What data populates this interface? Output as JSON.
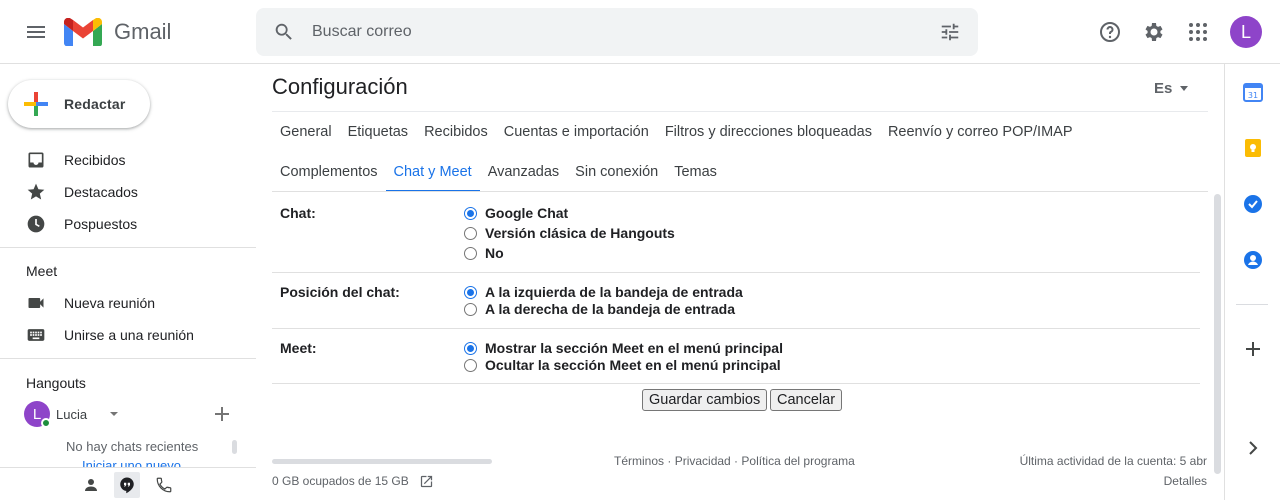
{
  "app": {
    "name": "Gmail"
  },
  "header": {
    "search_placeholder": "Buscar correo",
    "avatar_letter": "L"
  },
  "leftnav": {
    "compose_label": "Redactar",
    "items": [
      {
        "label": "Recibidos",
        "icon": "inbox-icon"
      },
      {
        "label": "Destacados",
        "icon": "star-icon"
      },
      {
        "label": "Pospuestos",
        "icon": "clock-icon"
      }
    ],
    "meet": {
      "title": "Meet",
      "items": [
        {
          "label": "Nueva reunión",
          "icon": "videocam-icon"
        },
        {
          "label": "Unirse a una reunión",
          "icon": "keyboard-icon"
        }
      ]
    },
    "hangouts": {
      "title": "Hangouts",
      "user_letter": "L",
      "user_name": "Lucia",
      "no_chats": "No hay chats recientes",
      "start_new": "Iniciar uno nuevo"
    }
  },
  "main": {
    "title": "Configuración",
    "language": "Es",
    "tabs_row1": [
      "General",
      "Etiquetas",
      "Recibidos",
      "Cuentas e importación",
      "Filtros y direcciones bloqueadas",
      "Reenvío y correo POP/IMAP"
    ],
    "tabs_row2": [
      "Complementos",
      "Chat y Meet",
      "Avanzadas",
      "Sin conexión",
      "Temas"
    ],
    "active_tab": "Chat y Meet",
    "settings": {
      "chat": {
        "label": "Chat:",
        "options": [
          "Google Chat",
          "Versión clásica de Hangouts",
          "No"
        ],
        "selected": "Google Chat"
      },
      "chat_position": {
        "label": "Posición del chat:",
        "options": [
          "A la izquierda de la bandeja de entrada",
          "A la derecha de la bandeja de entrada"
        ],
        "selected": "A la izquierda de la bandeja de entrada"
      },
      "meet": {
        "label": "Meet:",
        "options": [
          "Mostrar la sección Meet en el menú principal",
          "Ocultar la sección Meet en el menú principal"
        ],
        "selected": "Mostrar la sección Meet en el menú principal"
      }
    },
    "buttons": {
      "save": "Guardar cambios",
      "cancel": "Cancelar"
    },
    "footer": {
      "storage": "0 GB ocupados de 15 GB",
      "terms": "Términos",
      "privacy": "Privacidad",
      "policy": "Política del programa",
      "sep": " · ",
      "last_activity": "Última actividad de la cuenta: 5 abr",
      "details": "Detalles"
    }
  },
  "colors": {
    "accent": "#1a73e8",
    "avatar": "#8e44c9",
    "online": "#1e8e3e"
  }
}
